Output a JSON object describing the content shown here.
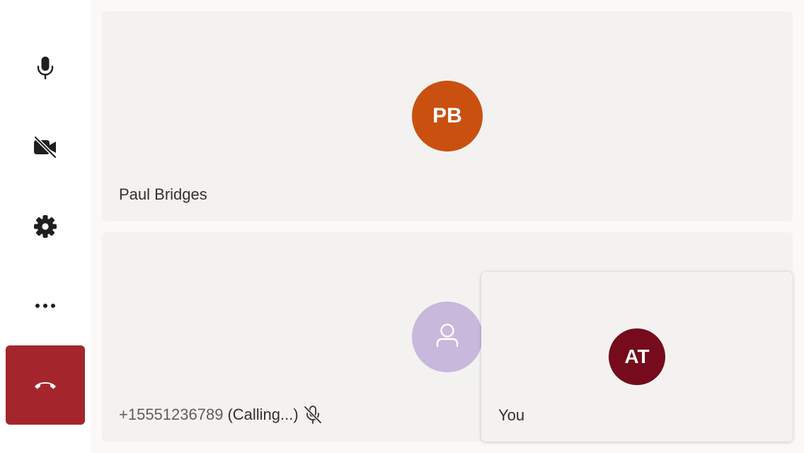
{
  "controls": {
    "microphone": {
      "icon": "microphone-icon"
    },
    "camera": {
      "icon": "camera-off-icon"
    },
    "settings": {
      "icon": "gear-icon"
    },
    "more": {
      "icon": "more-icon"
    },
    "hangup": {
      "icon": "phone-hangup-icon",
      "color": "#a4262c"
    }
  },
  "participants": [
    {
      "initials": "PB",
      "name": "Paul Bridges",
      "avatar_color": "#ca5010"
    },
    {
      "number": "+15551236789",
      "status": "(Calling...)",
      "avatar_color": "#c8b8dc",
      "avatar_icon": "person-icon",
      "status_icon": "mic-off-icon"
    }
  ],
  "self": {
    "initials": "AT",
    "name": "You",
    "avatar_color": "#750b1c"
  }
}
